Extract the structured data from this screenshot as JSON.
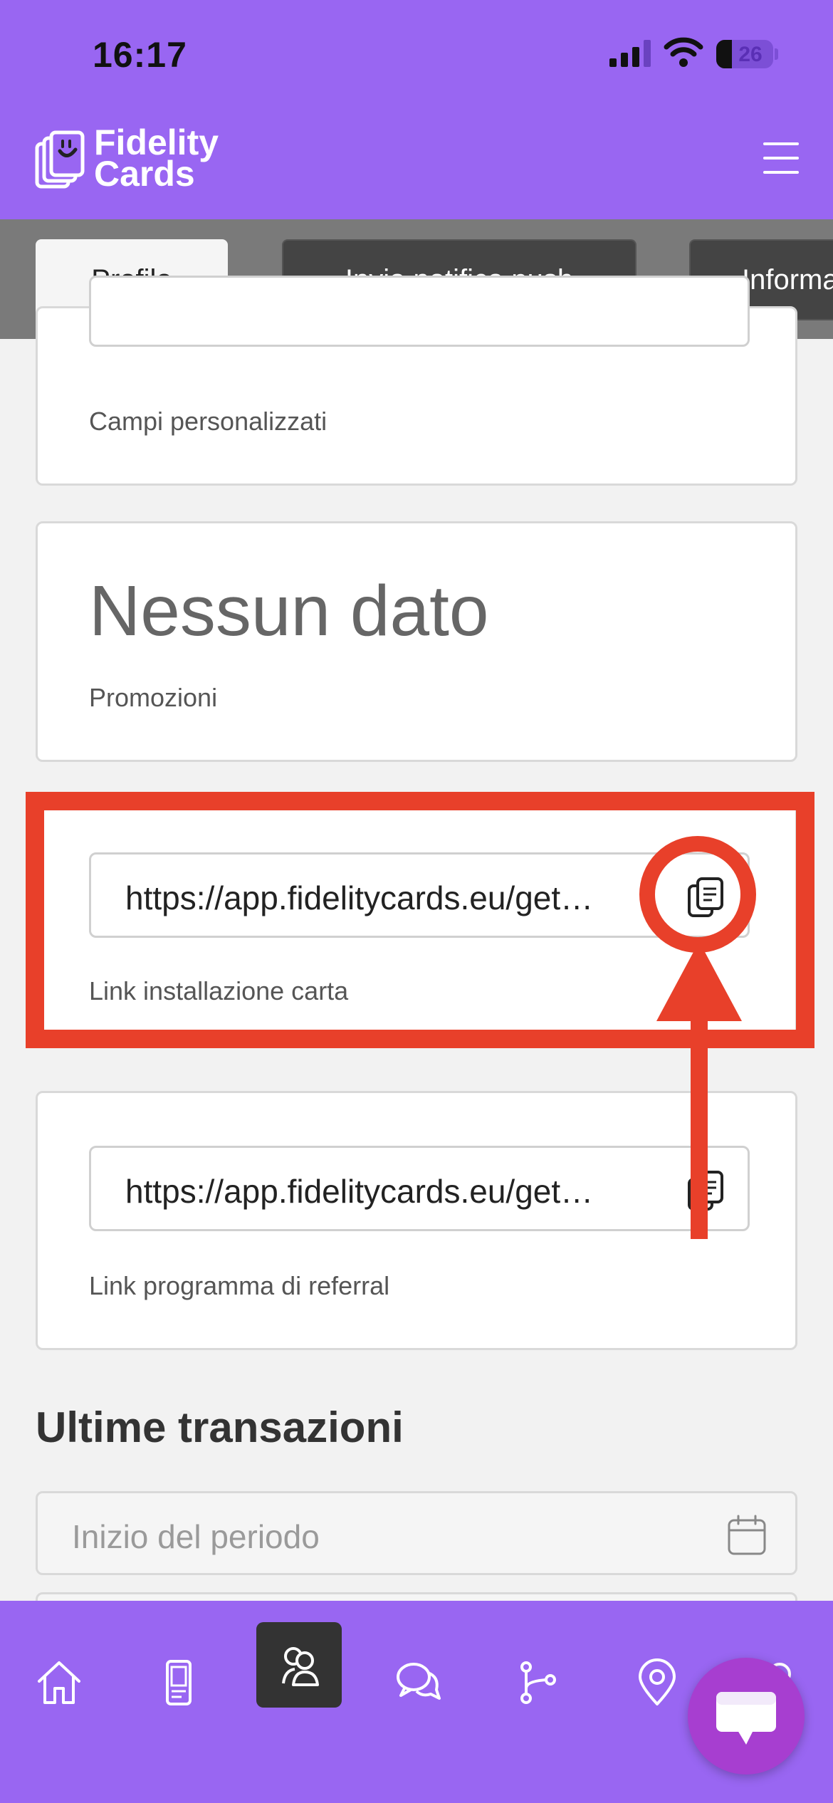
{
  "status_bar": {
    "time": "16:17",
    "battery": "26"
  },
  "header": {
    "logo_line1": "Fidelity",
    "logo_line2": "Cards"
  },
  "tabs": [
    {
      "label": "Profilo"
    },
    {
      "label": "Invia notifica push"
    },
    {
      "label": "Informa"
    }
  ],
  "content": {
    "custom_fields_caption": "Campi personalizzati",
    "promotions": {
      "value": "Nessun dato",
      "caption": "Promozioni"
    },
    "install_link": {
      "value": "https://app.fidelitycards.eu/get…",
      "caption": "Link installazione carta"
    },
    "referral_link": {
      "value": "https://app.fidelitycards.eu/get…",
      "caption": "Link programma di referral"
    },
    "transactions_title": "Ultime transazioni",
    "start_date_placeholder": "Inizio del periodo"
  },
  "colors": {
    "brand": "#9966f2",
    "annotation": "#e8402a",
    "chat_fab": "#a73ed0"
  },
  "icons": [
    "menu-icon",
    "copy-icon",
    "calendar-icon",
    "home-icon",
    "card-device-icon",
    "customers-icon",
    "chat-icon",
    "workflow-icon",
    "location-icon",
    "profile-icon"
  ]
}
